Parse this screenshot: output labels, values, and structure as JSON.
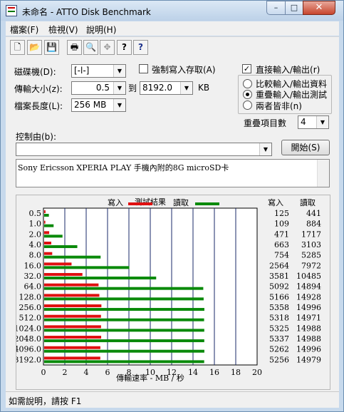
{
  "window": {
    "title": "未命名 - ATTO Disk Benchmark",
    "min_label": "–",
    "max_label": "□",
    "close_label": "✕"
  },
  "menu": [
    {
      "label": "檔案(F)"
    },
    {
      "label": "檢視(V)"
    },
    {
      "label": "說明(H)"
    }
  ],
  "toolbar": {
    "icons": [
      "new-file-icon",
      "open-folder-icon",
      "save-icon",
      "print-icon",
      "print-preview-icon",
      "move-icon",
      "help-icon",
      "context-help-icon"
    ],
    "glyphs": [
      "🗋",
      "📂",
      "💾",
      "🖶",
      "🔍",
      "✥",
      "?",
      "?"
    ]
  },
  "settings": {
    "drive_label": "磁碟機(D):",
    "drive_value": "[-l-]",
    "force_write_label": "強制寫入存取(A)",
    "force_write_checked": false,
    "transfer_size_label": "傳輸大小(z):",
    "transfer_from": "0.5",
    "transfer_to_label": "到",
    "transfer_to": "8192.0",
    "transfer_unit": "KB",
    "file_length_label": "檔案長度(L):",
    "file_length_value": "256 MB",
    "direct_io_label": "直接輸入/輸出(r)",
    "direct_io_checked": true,
    "mode_options": [
      "比較輸入/輸出資料",
      "重疊輸入/輸出測試",
      "兩者皆非(n)"
    ],
    "mode_selected": 1,
    "queue_depth_label": "重疊項目數",
    "queue_depth_value": "4",
    "controlled_by_label": "控制由(b):",
    "controlled_by_value": "",
    "start_button": "開始(S)",
    "description": "Sony Ericsson XPERIA PLAY 手機內附的8G microSD卡"
  },
  "results": {
    "group_title": "測試結果",
    "legend_write": "寫入",
    "legend_read": "讀取",
    "col_write": "寫入",
    "col_read": "讀取",
    "write_color": "#e01010",
    "read_color": "#0a8a0a"
  },
  "chart_data": {
    "type": "bar",
    "orientation": "horizontal",
    "categories": [
      "0.5",
      "1.0",
      "2.0",
      "4.0",
      "8.0",
      "16.0",
      "32.0",
      "64.0",
      "128.0",
      "256.0",
      "512.0",
      "1024.0",
      "2048.0",
      "4096.0",
      "3192.0"
    ],
    "series": [
      {
        "name": "寫入",
        "values": [
          125,
          109,
          471,
          663,
          754,
          2564,
          3581,
          5092,
          5166,
          5358,
          5318,
          5325,
          5337,
          5262,
          5256
        ]
      },
      {
        "name": "讀取",
        "values": [
          441,
          884,
          1717,
          3103,
          5285,
          7972,
          10485,
          14894,
          14928,
          14996,
          14971,
          14988,
          14988,
          14996,
          14979
        ]
      }
    ],
    "xlabel": "傳輸速率 - MB / 秒",
    "xticks": [
      "0",
      "2",
      "4",
      "6",
      "8",
      "10",
      "12",
      "14",
      "16",
      "18",
      "20"
    ],
    "xlim": [
      0,
      20
    ],
    "value_unit": "KB/s",
    "grid": true
  },
  "status": {
    "text": "如需說明，請按 F1"
  }
}
